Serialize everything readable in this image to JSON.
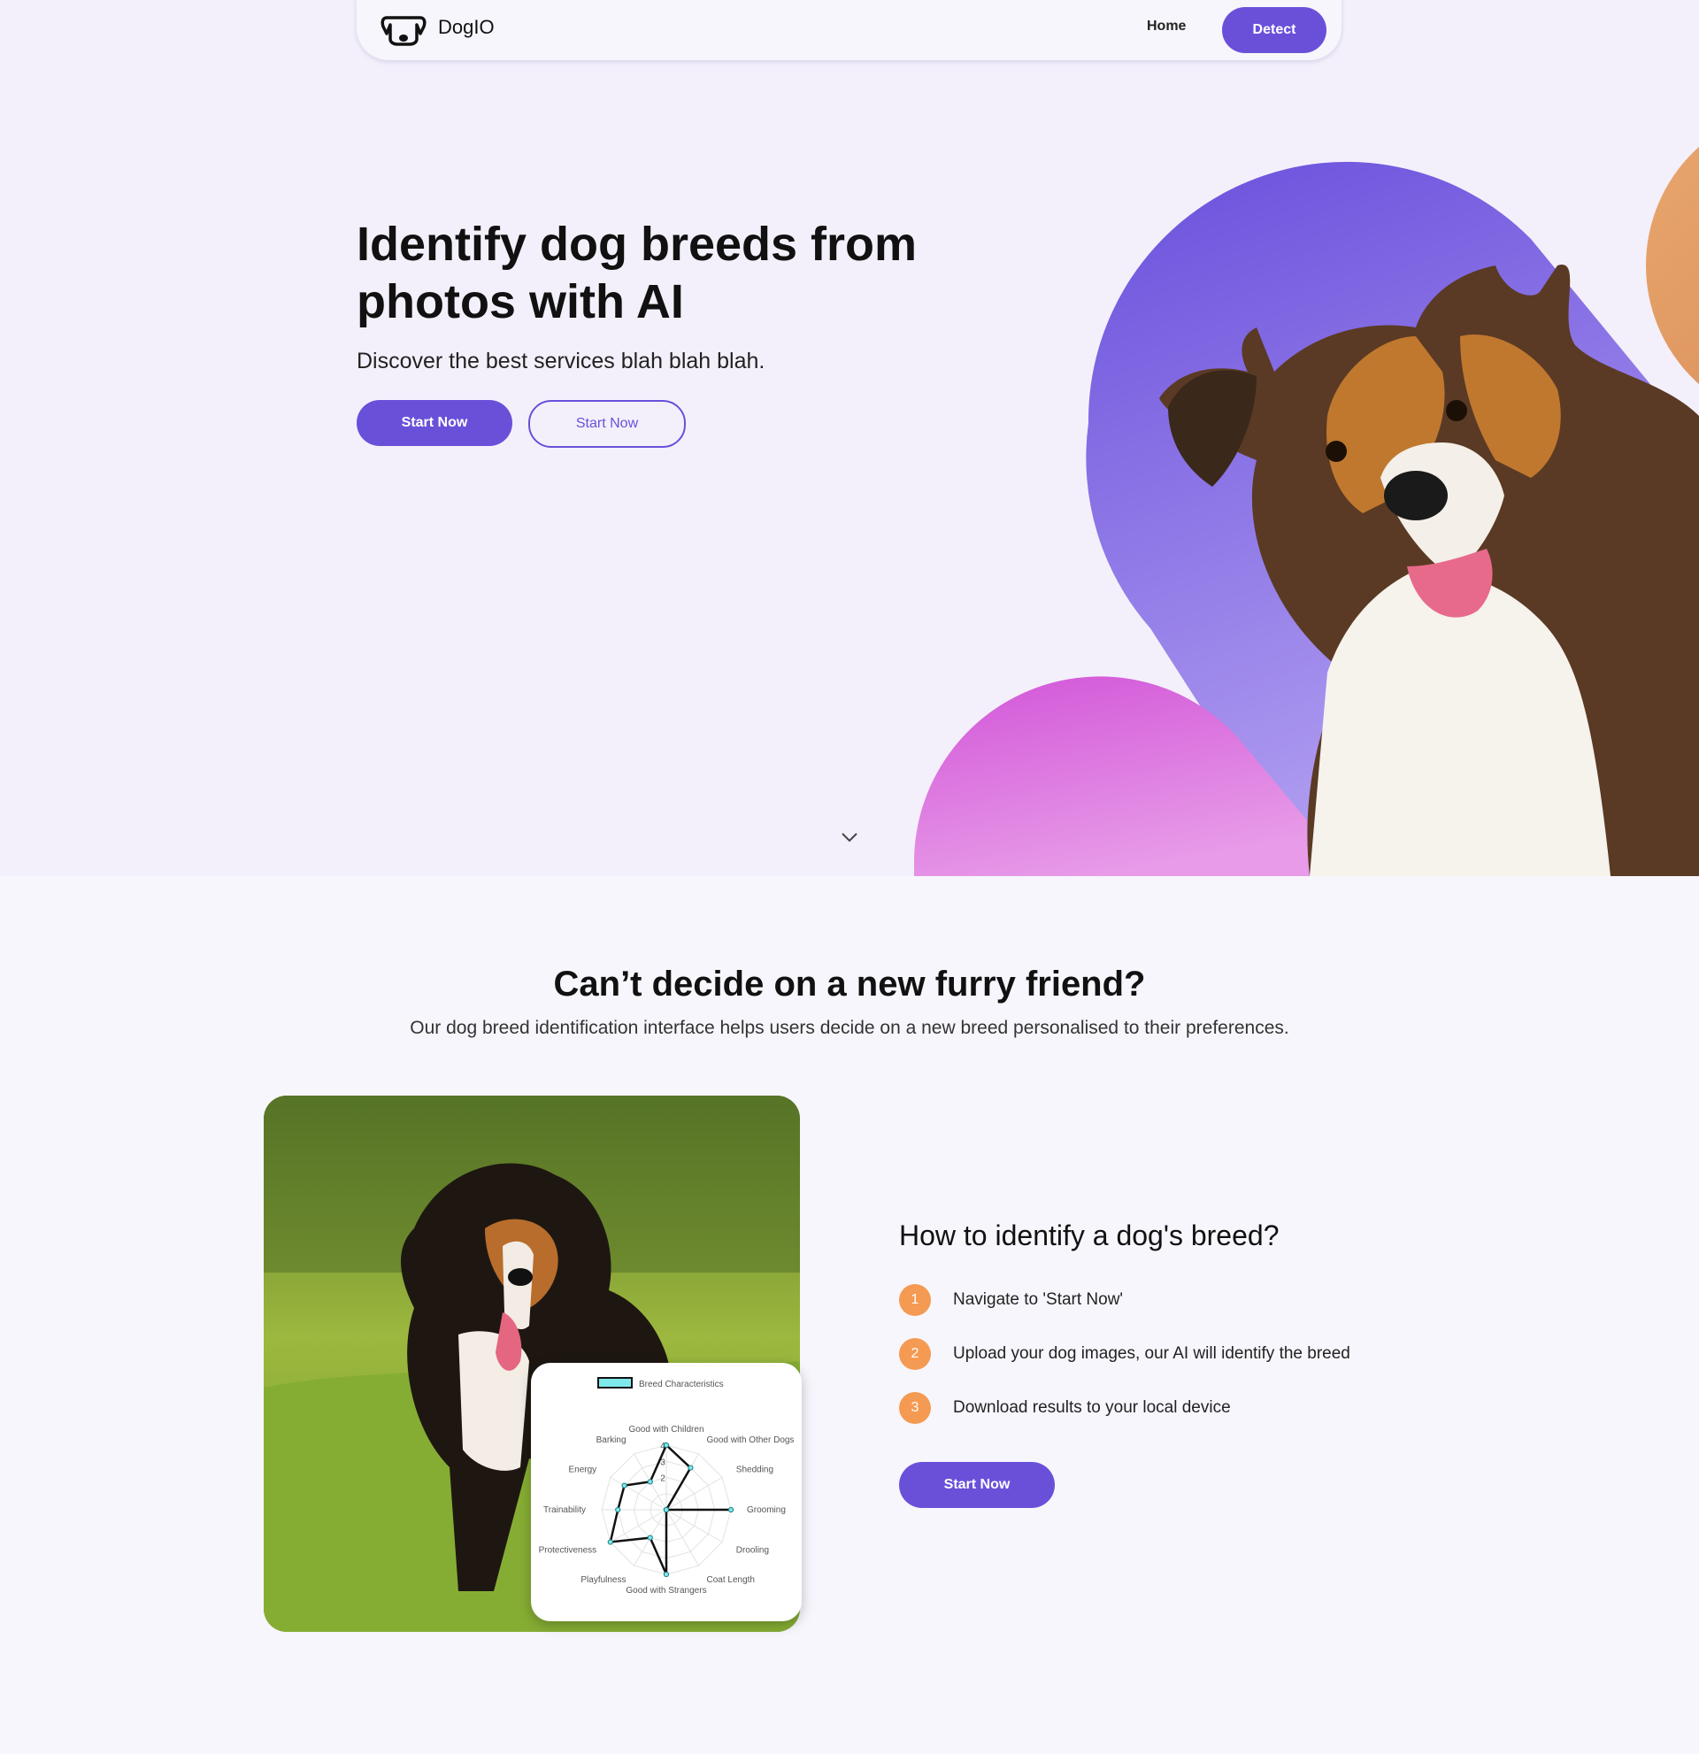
{
  "nav": {
    "brand": "DogIO",
    "home_label": "Home",
    "detect_label": "Detect"
  },
  "hero": {
    "title": "Identify dog breeds from photos with AI",
    "subtitle": "Discover the best services blah blah blah.",
    "primary_button": "Start Now",
    "secondary_button": "Start Now"
  },
  "section": {
    "title": "Can’t decide on a new furry friend?",
    "subtitle": "Our dog breed identification interface helps users decide on a new breed personalised to their preferences."
  },
  "how_to": {
    "title": "How to identify a dog's breed?",
    "steps": [
      {
        "num": "1",
        "text": "Navigate to 'Start Now'"
      },
      {
        "num": "2",
        "text": "Upload your dog images, our AI will identify the breed"
      },
      {
        "num": "3",
        "text": "Download results to your local device"
      }
    ],
    "button": "Start Now"
  },
  "colors": {
    "accent": "#6a50d9",
    "step_badge": "#f59a52",
    "hero_purple": "#7a5ae0",
    "hero_pink": "#d45ed9",
    "hero_orange": "#e0a070"
  },
  "chart_data": {
    "type": "radar",
    "legend": "Breed Characteristics",
    "axes": [
      "Good with Children",
      "Good with Other Dogs",
      "Shedding",
      "Grooming",
      "Drooling",
      "Coat Length",
      "Good with Strangers",
      "Playfulness",
      "Protectiveness",
      "Trainability",
      "Energy",
      "Barking"
    ],
    "values": [
      4,
      3,
      0,
      4,
      0,
      0,
      4,
      2,
      4,
      3,
      3,
      2
    ],
    "rlim": [
      0,
      4
    ],
    "rticks": [
      "2",
      "3",
      "4"
    ]
  }
}
